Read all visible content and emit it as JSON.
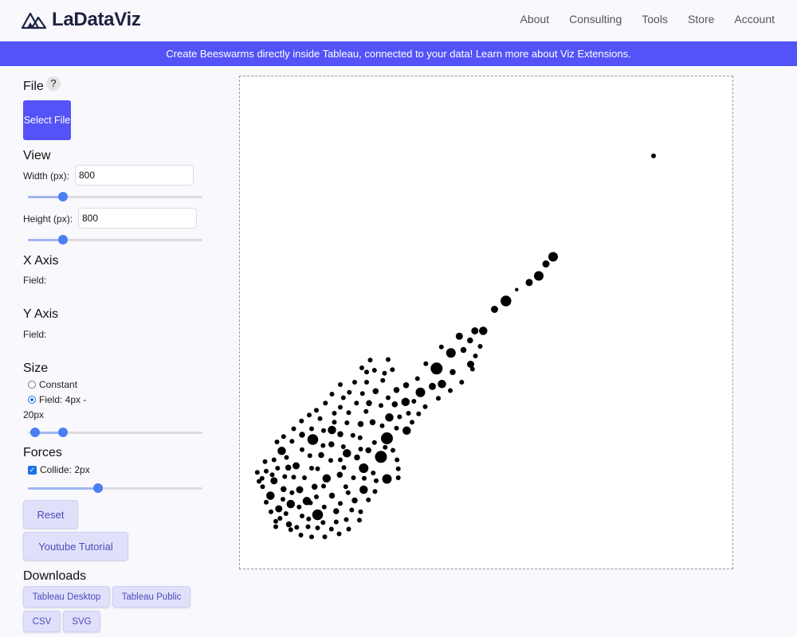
{
  "header": {
    "brand": "LaDataViz",
    "nav": [
      "About",
      "Consulting",
      "Tools",
      "Store",
      "Account"
    ]
  },
  "banner": {
    "text": "Create Beeswarms directly inside Tableau, connected to your data! Learn more about Viz Extensions."
  },
  "sidebar": {
    "file": {
      "title": "File",
      "help": "?",
      "select_label": "Select File"
    },
    "view": {
      "title": "View",
      "width_label": "Width (px):",
      "width_value": "800",
      "width_slider": 0.2,
      "height_label": "Height (px):",
      "height_value": "800",
      "height_slider": 0.2
    },
    "x_axis": {
      "title": "X Axis",
      "field_label": "Field:"
    },
    "y_axis": {
      "title": "Y Axis",
      "field_label": "Field:"
    },
    "size": {
      "title": "Size",
      "constant_label": "Constant",
      "field_label": "Field: 4px -",
      "field_label_cont": "20px",
      "selected": "field",
      "range_slider": [
        0.04,
        0.2
      ]
    },
    "forces": {
      "title": "Forces",
      "collide_label": "Collide: 2px",
      "collide_checked": true,
      "collide_slider": 0.4
    },
    "buttons": {
      "reset": "Reset",
      "tutorial": "Youtube Tutorial"
    },
    "downloads": {
      "title": "Downloads",
      "items": [
        "Tableau Desktop",
        "Tableau Public",
        "CSV",
        "SVG"
      ]
    }
  },
  "colors": {
    "accent": "#5353f7",
    "slider": "#4c7ef3",
    "point": "#000000",
    "soft_button": "#e0e0fb"
  },
  "chart_data": {
    "type": "scatter",
    "title": "",
    "xlabel": "",
    "ylabel": "",
    "xlim": [
      0,
      800
    ],
    "ylim": [
      0,
      800
    ],
    "grid": false,
    "points": [
      {
        "x": 680,
        "y": 679,
        "r": 8
      },
      {
        "x": 512,
        "y": 510,
        "r": 16
      },
      {
        "x": 488,
        "y": 478,
        "r": 16
      },
      {
        "x": 500,
        "y": 498,
        "r": 12
      },
      {
        "x": 472,
        "y": 467,
        "r": 12
      },
      {
        "x": 433,
        "y": 436,
        "r": 18
      },
      {
        "x": 414,
        "y": 422,
        "r": 12
      },
      {
        "x": 395,
        "y": 386,
        "r": 14
      },
      {
        "x": 355,
        "y": 377,
        "r": 12
      },
      {
        "x": 317,
        "y": 323,
        "r": 20
      },
      {
        "x": 341,
        "y": 349,
        "r": 16
      },
      {
        "x": 326,
        "y": 297,
        "r": 14
      },
      {
        "x": 290,
        "y": 283,
        "r": 16
      },
      {
        "x": 265,
        "y": 267,
        "r": 14
      },
      {
        "x": 238,
        "y": 241,
        "r": 14
      },
      {
        "x": 234,
        "y": 206,
        "r": 20
      },
      {
        "x": 267,
        "y": 219,
        "r": 14
      },
      {
        "x": 224,
        "y": 175,
        "r": 20
      },
      {
        "x": 234,
        "y": 138,
        "r": 16
      },
      {
        "x": 195,
        "y": 156,
        "r": 16
      },
      {
        "x": 195,
        "y": 120,
        "r": 14
      },
      {
        "x": 167,
        "y": 181,
        "r": 14
      },
      {
        "x": 142,
        "y": 220,
        "r": 14
      },
      {
        "x": 110,
        "y": 204,
        "r": 18
      },
      {
        "x": 133,
        "y": 139,
        "r": 14
      },
      {
        "x": 100,
        "y": 101,
        "r": 14
      },
      {
        "x": 118,
        "y": 78,
        "r": 18
      },
      {
        "x": 73,
        "y": 96,
        "r": 14
      },
      {
        "x": 88,
        "y": 120,
        "r": 12
      },
      {
        "x": 45,
        "y": 135,
        "r": 12
      },
      {
        "x": 39,
        "y": 110,
        "r": 14
      },
      {
        "x": 53,
        "y": 88,
        "r": 12
      },
      {
        "x": 58,
        "y": 185,
        "r": 14
      },
      {
        "x": 82,
        "y": 160,
        "r": 12
      },
      {
        "x": 149,
        "y": 84,
        "r": 10
      },
      {
        "x": 180,
        "y": 102,
        "r": 10
      },
      {
        "x": 69,
        "y": 157,
        "r": 10
      },
      {
        "x": 48,
        "y": 58,
        "r": 8
      },
      {
        "x": 70,
        "y": 62,
        "r": 10
      },
      {
        "x": 166,
        "y": 70,
        "r": 8
      },
      {
        "x": 142,
        "y": 110,
        "r": 10
      },
      {
        "x": 127,
        "y": 65,
        "r": 8
      },
      {
        "x": 113,
        "y": 125,
        "r": 10
      },
      {
        "x": 61,
        "y": 121,
        "r": 10
      },
      {
        "x": 32,
        "y": 151,
        "r": 8
      },
      {
        "x": 30,
        "y": 167,
        "r": 8
      },
      {
        "x": 92,
        "y": 76,
        "r": 8
      },
      {
        "x": 106,
        "y": 98,
        "r": 8
      },
      {
        "x": 165,
        "y": 125,
        "r": 8
      },
      {
        "x": 178,
        "y": 140,
        "r": 8
      },
      {
        "x": 155,
        "y": 145,
        "r": 10
      },
      {
        "x": 203,
        "y": 186,
        "r": 10
      },
      {
        "x": 184,
        "y": 174,
        "r": 10
      },
      {
        "x": 210,
        "y": 233,
        "r": 10
      },
      {
        "x": 190,
        "y": 230,
        "r": 10
      },
      {
        "x": 156,
        "y": 213,
        "r": 10
      },
      {
        "x": 141,
        "y": 196,
        "r": 10
      },
      {
        "x": 124,
        "y": 178,
        "r": 10
      },
      {
        "x": 92,
        "y": 212,
        "r": 10
      },
      {
        "x": 140,
        "y": 169,
        "r": 8
      },
      {
        "x": 118,
        "y": 155,
        "r": 8
      },
      {
        "x": 96,
        "y": 140,
        "r": 8
      },
      {
        "x": 63,
        "y": 142,
        "r": 8
      },
      {
        "x": 204,
        "y": 265,
        "r": 10
      },
      {
        "x": 224,
        "y": 261,
        "r": 8
      },
      {
        "x": 247,
        "y": 263,
        "r": 10
      },
      {
        "x": 215,
        "y": 285,
        "r": 10
      },
      {
        "x": 250,
        "y": 287,
        "r": 10
      },
      {
        "x": 266,
        "y": 295,
        "r": 10
      },
      {
        "x": 310,
        "y": 293,
        "r": 12
      },
      {
        "x": 344,
        "y": 317,
        "r": 10
      },
      {
        "x": 374,
        "y": 330,
        "r": 12
      },
      {
        "x": 362,
        "y": 354,
        "r": 10
      },
      {
        "x": 373,
        "y": 370,
        "r": 10
      },
      {
        "x": 381,
        "y": 386,
        "r": 12
      },
      {
        "x": 451,
        "y": 455,
        "r": 6
      },
      {
        "x": 377,
        "y": 322,
        "r": 8
      },
      {
        "x": 325,
        "y": 359,
        "r": 8
      },
      {
        "x": 299,
        "y": 331,
        "r": 8
      },
      {
        "x": 285,
        "y": 306,
        "r": 8
      },
      {
        "x": 298,
        "y": 259,
        "r": 8
      },
      {
        "x": 320,
        "y": 273,
        "r": 8
      },
      {
        "x": 340,
        "y": 286,
        "r": 8
      },
      {
        "x": 359,
        "y": 300,
        "r": 8
      },
      {
        "x": 382,
        "y": 344,
        "r": 8
      },
      {
        "x": 390,
        "y": 360,
        "r": 8
      },
      {
        "x": 255,
        "y": 242,
        "r": 8
      },
      {
        "x": 250,
        "y": 223,
        "r": 8
      },
      {
        "x": 270,
        "y": 248,
        "r": 8
      },
      {
        "x": 279,
        "y": 268,
        "r": 8
      },
      {
        "x": 236,
        "y": 274,
        "r": 8
      },
      {
        "x": 227,
        "y": 303,
        "r": 8
      },
      {
        "x": 230,
        "y": 315,
        "r": 8
      },
      {
        "x": 243,
        "y": 321,
        "r": 8
      },
      {
        "x": 236,
        "y": 338,
        "r": 8
      },
      {
        "x": 200,
        "y": 300,
        "r": 8
      },
      {
        "x": 193,
        "y": 281,
        "r": 8
      },
      {
        "x": 183,
        "y": 265,
        "r": 8
      },
      {
        "x": 170,
        "y": 249,
        "r": 8
      },
      {
        "x": 167,
        "y": 232,
        "r": 8
      },
      {
        "x": 177,
        "y": 211,
        "r": 8
      },
      {
        "x": 189,
        "y": 207,
        "r": 8
      },
      {
        "x": 128,
        "y": 219,
        "r": 8
      },
      {
        "x": 122,
        "y": 239,
        "r": 8
      },
      {
        "x": 108,
        "y": 222,
        "r": 8
      },
      {
        "x": 78,
        "y": 222,
        "r": 8
      },
      {
        "x": 75,
        "y": 201,
        "r": 8
      },
      {
        "x": 92,
        "y": 187,
        "r": 8
      },
      {
        "x": 105,
        "y": 177,
        "r": 8
      },
      {
        "x": 108,
        "y": 156,
        "r": 8
      },
      {
        "x": 127,
        "y": 194,
        "r": 8
      },
      {
        "x": 146,
        "y": 233,
        "r": 8
      },
      {
        "x": 146,
        "y": 248,
        "r": 8
      },
      {
        "x": 156,
        "y": 258,
        "r": 8
      },
      {
        "x": 161,
        "y": 274,
        "r": 8
      },
      {
        "x": 171,
        "y": 283,
        "r": 8
      },
      {
        "x": 180,
        "y": 300,
        "r": 8
      },
      {
        "x": 192,
        "y": 324,
        "r": 8
      },
      {
        "x": 206,
        "y": 337,
        "r": 8
      },
      {
        "x": 200,
        "y": 317,
        "r": 8
      },
      {
        "x": 213,
        "y": 320,
        "r": 8
      },
      {
        "x": 156,
        "y": 296,
        "r": 8
      },
      {
        "x": 142,
        "y": 280,
        "r": 8
      },
      {
        "x": 131,
        "y": 265,
        "r": 8
      },
      {
        "x": 116,
        "y": 253,
        "r": 8
      },
      {
        "x": 104,
        "y": 245,
        "r": 8
      },
      {
        "x": 91,
        "y": 235,
        "r": 8
      },
      {
        "x": 61,
        "y": 209,
        "r": 8
      },
      {
        "x": 50,
        "y": 200,
        "r": 8
      },
      {
        "x": 45,
        "y": 170,
        "r": 8
      },
      {
        "x": 25,
        "y": 139,
        "r": 8
      },
      {
        "x": 26,
        "y": 125,
        "r": 8
      },
      {
        "x": 32,
        "y": 99,
        "r": 8
      },
      {
        "x": 40,
        "y": 83,
        "r": 8
      },
      {
        "x": 55,
        "y": 72,
        "r": 8
      },
      {
        "x": 75,
        "y": 115,
        "r": 8
      },
      {
        "x": 78,
        "y": 141,
        "r": 8
      },
      {
        "x": 51,
        "y": 156,
        "r": 8
      },
      {
        "x": 42,
        "y": 145,
        "r": 8
      },
      {
        "x": 66,
        "y": 174,
        "r": 8
      },
      {
        "x": 87,
        "y": 91,
        "r": 8
      },
      {
        "x": 103,
        "y": 71,
        "r": 8
      },
      {
        "x": 129,
        "y": 91,
        "r": 8
      },
      {
        "x": 149,
        "y": 66,
        "r": 8
      },
      {
        "x": 156,
        "y": 97,
        "r": 8
      },
      {
        "x": 175,
        "y": 86,
        "r": 8
      },
      {
        "x": 190,
        "y": 83,
        "r": 8
      },
      {
        "x": 196,
        "y": 139,
        "r": 8
      },
      {
        "x": 211,
        "y": 148,
        "r": 8
      },
      {
        "x": 216,
        "y": 135,
        "r": 8
      },
      {
        "x": 190,
        "y": 188,
        "r": 8
      },
      {
        "x": 213,
        "y": 199,
        "r": 8
      },
      {
        "x": 161,
        "y": 192,
        "r": 8
      },
      {
        "x": 156,
        "y": 170,
        "r": 8
      },
      {
        "x": 162,
        "y": 157,
        "r": 8
      },
      {
        "x": 128,
        "y": 126,
        "r": 8
      },
      {
        "x": 116,
        "y": 108,
        "r": 8
      },
      {
        "x": 169,
        "y": 115,
        "r": 8
      },
      {
        "x": 141,
        "y": 54,
        "r": 8
      },
      {
        "x": 118,
        "y": 56,
        "r": 8
      },
      {
        "x": 102,
        "y": 58,
        "r": 8
      },
      {
        "x": 83,
        "y": 57,
        "r": 8
      },
      {
        "x": 65,
        "y": 80,
        "r": 8
      },
      {
        "x": 60,
        "y": 104,
        "r": 8
      },
      {
        "x": 17,
        "y": 149,
        "r": 8
      },
      {
        "x": 20,
        "y": 134,
        "r": 8
      },
      {
        "x": 73,
        "y": 53,
        "r": 8
      },
      {
        "x": 48,
        "y": 67,
        "r": 8
      },
      {
        "x": 199,
        "y": 251,
        "r": 8
      },
      {
        "x": 226,
        "y": 227,
        "r": 8
      },
      {
        "x": 276,
        "y": 233,
        "r": 8
      },
      {
        "x": 287,
        "y": 247,
        "r": 8
      },
      {
        "x": 231,
        "y": 191,
        "r": 8
      },
      {
        "x": 244,
        "y": 186,
        "r": 8
      },
      {
        "x": 251,
        "y": 170,
        "r": 8
      },
      {
        "x": 253,
        "y": 155,
        "r": 8
      },
      {
        "x": 253,
        "y": 140,
        "r": 8
      },
      {
        "x": 214,
        "y": 117,
        "r": 8
      },
      {
        "x": 203,
        "y": 103,
        "r": 8
      },
      {
        "x": 188,
        "y": 69,
        "r": 8
      },
      {
        "x": 170,
        "y": 54,
        "r": 8
      },
      {
        "x": 154,
        "y": 46,
        "r": 8
      },
      {
        "x": 130,
        "y": 41,
        "r": 8
      },
      {
        "x": 108,
        "y": 41,
        "r": 8
      },
      {
        "x": 90,
        "y": 44,
        "r": 8
      }
    ]
  }
}
